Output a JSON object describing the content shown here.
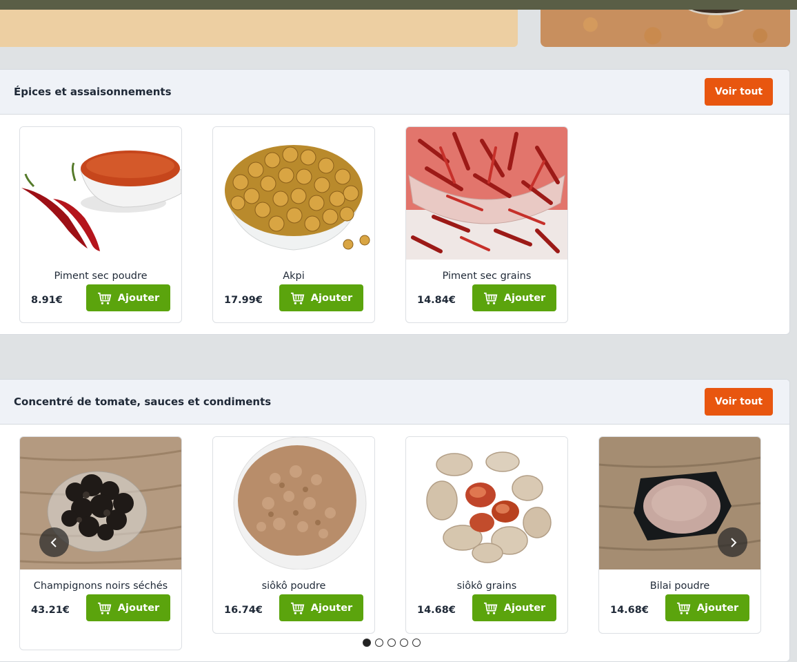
{
  "sections": [
    {
      "title": "Épices et assaisonnements",
      "cta": "Voir tout",
      "products": [
        {
          "name": "Piment sec poudre",
          "price": "8.91€",
          "add_label": "Ajouter",
          "image": "chili-powder-image"
        },
        {
          "name": "Akpi",
          "price": "17.99€",
          "add_label": "Ajouter",
          "image": "akpi-seeds-image"
        },
        {
          "name": "Piment sec grains",
          "price": "14.84€",
          "add_label": "Ajouter",
          "image": "dried-chili-image"
        }
      ]
    },
    {
      "title": "Concentré de tomate, sauces et condiments",
      "cta": "Voir tout",
      "products": [
        {
          "name": "Champignons noirs séchés",
          "price": "43.21€",
          "add_label": "Ajouter",
          "image": "black-mushroom-image"
        },
        {
          "name": "siôkô poudre",
          "price": "16.74€",
          "add_label": "Ajouter",
          "image": "sioko-powder-image"
        },
        {
          "name": "siôkô grains",
          "price": "14.68€",
          "add_label": "Ajouter",
          "image": "sioko-grains-image"
        },
        {
          "name": "Bilai poudre",
          "price": "14.68€",
          "add_label": "Ajouter",
          "image": "bilai-powder-image"
        }
      ]
    }
  ],
  "carousel": {
    "page_count": 5,
    "active_page": 1
  },
  "icons": {
    "cart": "cart-icon",
    "prev": "chevron-left-icon",
    "next": "chevron-right-icon"
  },
  "colors": {
    "cta": "#e8560f",
    "add": "#5ba40d",
    "header_bg": "#eff2f7",
    "page_bg": "#dfe2e4"
  }
}
